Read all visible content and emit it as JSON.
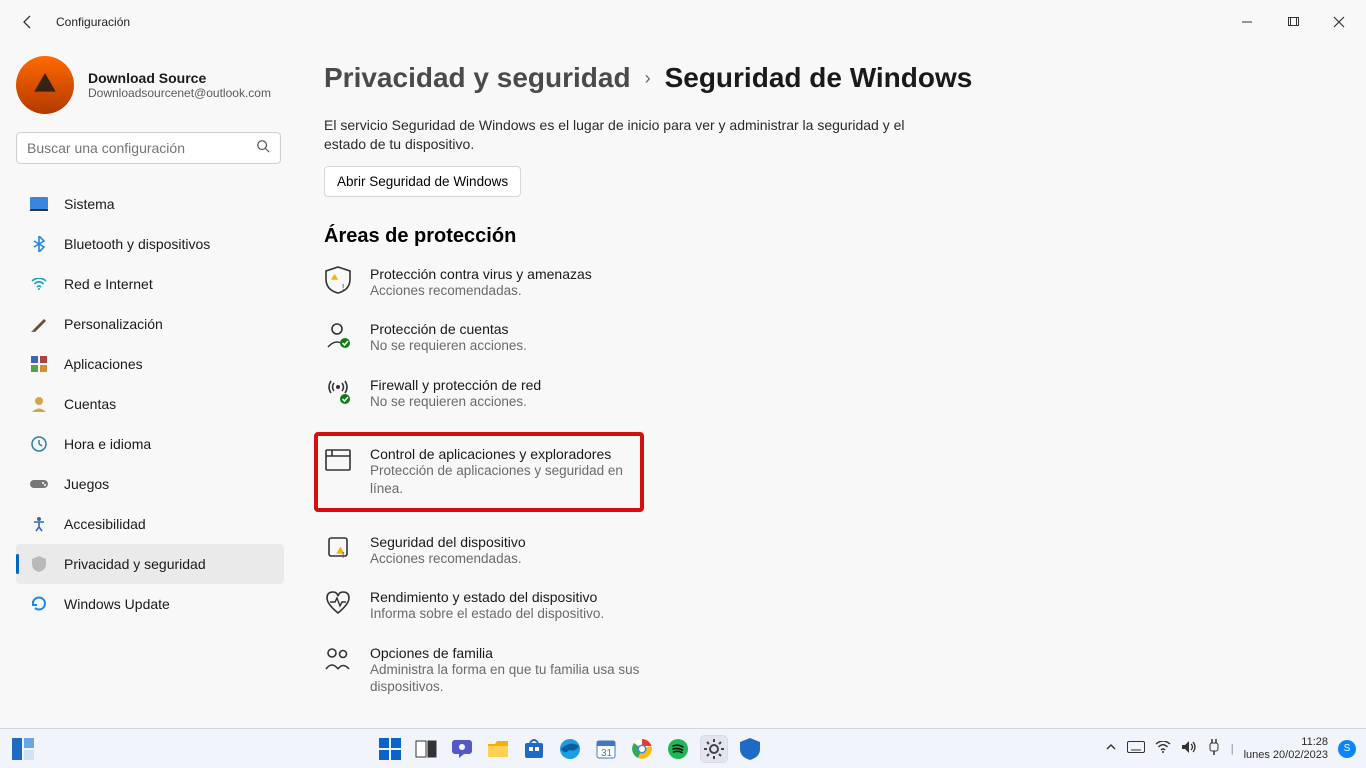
{
  "window": {
    "title": "Configuración"
  },
  "account": {
    "name": "Download Source",
    "email": "Downloadsourcenet@outlook.com"
  },
  "search": {
    "placeholder": "Buscar una configuración"
  },
  "sidebar": {
    "items": [
      {
        "id": "sistema",
        "label": "Sistema"
      },
      {
        "id": "bluetooth",
        "label": "Bluetooth y dispositivos"
      },
      {
        "id": "red",
        "label": "Red e Internet"
      },
      {
        "id": "personalizacion",
        "label": "Personalización"
      },
      {
        "id": "aplicaciones",
        "label": "Aplicaciones"
      },
      {
        "id": "cuentas",
        "label": "Cuentas"
      },
      {
        "id": "hora",
        "label": "Hora e idioma"
      },
      {
        "id": "juegos",
        "label": "Juegos"
      },
      {
        "id": "accesibilidad",
        "label": "Accesibilidad"
      },
      {
        "id": "privacidad",
        "label": "Privacidad y seguridad",
        "active": true
      },
      {
        "id": "update",
        "label": "Windows Update"
      }
    ]
  },
  "breadcrumb": {
    "parent": "Privacidad y seguridad",
    "current": "Seguridad de Windows"
  },
  "main": {
    "description": "El servicio Seguridad de Windows es el lugar de inicio para ver y administrar la seguridad y el estado de tu dispositivo.",
    "open_button": "Abrir Seguridad de Windows",
    "section_title": "Áreas de protección",
    "areas": [
      {
        "title": "Protección contra virus y amenazas",
        "sub": "Acciones recomendadas."
      },
      {
        "title": "Protección de cuentas",
        "sub": "No se requieren acciones."
      },
      {
        "title": "Firewall y protección de red",
        "sub": "No se requieren acciones."
      },
      {
        "title": "Control de aplicaciones y exploradores",
        "sub": "Protección de aplicaciones y seguridad en línea.",
        "highlighted": true
      },
      {
        "title": "Seguridad del dispositivo",
        "sub": "Acciones recomendadas."
      },
      {
        "title": "Rendimiento y estado del dispositivo",
        "sub": "Informa sobre el estado del dispositivo."
      },
      {
        "title": "Opciones de familia",
        "sub": "Administra la forma en que tu familia usa sus dispositivos."
      }
    ]
  },
  "taskbar": {
    "time": "11:28",
    "date": "lunes 20/02/2023",
    "user_initial": "S"
  }
}
